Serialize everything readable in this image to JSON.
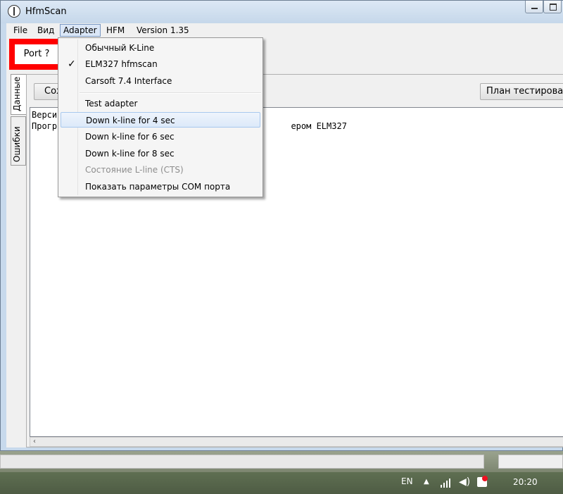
{
  "window": {
    "title": "HfmScan"
  },
  "menubar": {
    "items": [
      {
        "label": "File"
      },
      {
        "label": "Вид"
      },
      {
        "label": "Adapter"
      },
      {
        "label": "HFM"
      },
      {
        "label": "Version 1.35"
      }
    ]
  },
  "toolbar": {
    "port_label": "Port ?"
  },
  "tabs": [
    {
      "label": "Данные"
    },
    {
      "label": "Ошибки"
    }
  ],
  "panel": {
    "save_label": "Сохранить",
    "test_plan_label": "План тестирования"
  },
  "log": {
    "lines": [
      "Верси",
      "Прогр                                              ером ELM327"
    ]
  },
  "adapter_menu": {
    "items": [
      {
        "label": "Обычный K-Line",
        "checked": false,
        "enabled": true
      },
      {
        "label": "ELM327 hfmscan",
        "checked": true,
        "enabled": true
      },
      {
        "label": "Carsoft 7.4 Interface",
        "checked": false,
        "enabled": true
      },
      {
        "label": "Test adapter",
        "checked": false,
        "enabled": true
      },
      {
        "label": "Down k-line for 4 sec",
        "checked": false,
        "enabled": true,
        "highlighted": true
      },
      {
        "label": "Down k-line for 6 sec",
        "checked": false,
        "enabled": true
      },
      {
        "label": "Down k-line for 8 sec",
        "checked": false,
        "enabled": true
      },
      {
        "label": "Состояние L-line (CTS)",
        "checked": false,
        "enabled": false
      },
      {
        "label": "Показать параметры COM порта",
        "checked": false,
        "enabled": true
      }
    ],
    "check_glyph": "✓"
  },
  "taskbar": {
    "language": "EN",
    "clock": "20:20"
  },
  "colors": {
    "port_highlight": "#ff0000",
    "menu_hover": "#dce9f9"
  }
}
